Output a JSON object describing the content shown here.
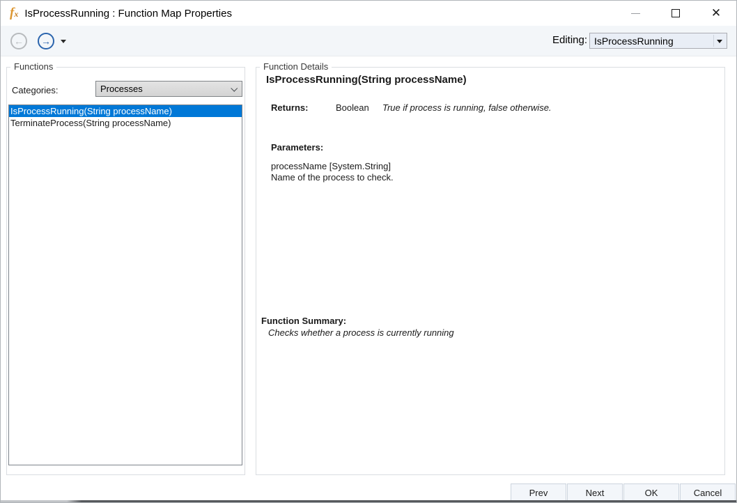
{
  "window": {
    "title": "IsProcessRunning : Function Map Properties",
    "icon": {
      "name": "fx-icon",
      "glyph_main": "f",
      "glyph_sub": "x",
      "color": "#dd9630"
    },
    "controls": {
      "minimize": "minimize",
      "maximize": "maximize",
      "close": "✕"
    }
  },
  "toolbar": {
    "back_icon": "←",
    "forward_icon": "→",
    "editing_label": "Editing:",
    "editing_value": "IsProcessRunning"
  },
  "functions_panel": {
    "title": "Functions",
    "categories_label": "Categories:",
    "categories_value": "Processes",
    "list": [
      {
        "label": "IsProcessRunning(String processName)",
        "selected": true
      },
      {
        "label": "TerminateProcess(String processName)",
        "selected": false
      }
    ]
  },
  "details_panel": {
    "title": "Function Details",
    "signature": "IsProcessRunning(String processName)",
    "returns_label": "Returns:",
    "returns_type": "Boolean",
    "returns_desc": "True if process is running, false otherwise.",
    "parameters_label": "Parameters:",
    "parameters": [
      {
        "name": "processName [System.String]",
        "desc": "Name of the process to check."
      }
    ],
    "summary_label": "Function Summary:",
    "summary_text": "Checks whether a process is currently running"
  },
  "footer": {
    "buttons": [
      {
        "label": "Prev"
      },
      {
        "label": "Next"
      },
      {
        "label": "OK"
      },
      {
        "label": "Cancel"
      }
    ]
  },
  "colors": {
    "selection_blue": "#0078d7",
    "forward_blue": "#2a64ad",
    "icon_orange": "#dd9630",
    "toolbar_bg": "#f3f6f9"
  }
}
